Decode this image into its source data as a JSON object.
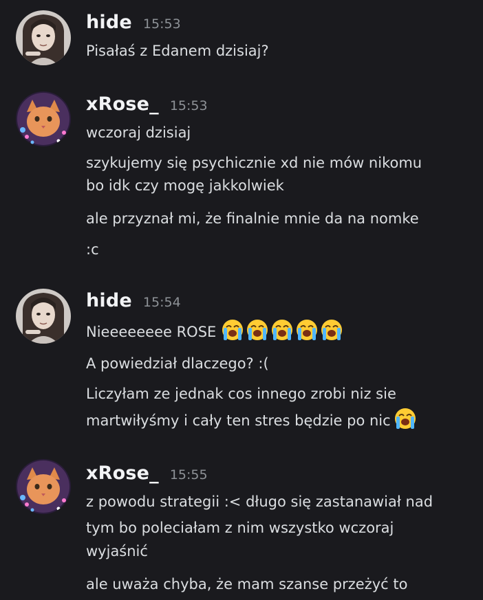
{
  "messages": [
    {
      "username": "hide",
      "timestamp": "15:53",
      "avatar": "hide-avatar",
      "lines": [
        "Pisałaś z Edanem dzisiaj?"
      ]
    },
    {
      "username": "xRose_",
      "timestamp": "15:53",
      "avatar": "xrose-avatar",
      "lines": [
        "wczoraj dzisiaj",
        "szykujemy się psychicznie xd nie mów nikomu",
        "bo idk czy mogę jakkolwiek",
        "ale przyznał mi, że finalnie mnie da na nomke",
        ":c"
      ]
    },
    {
      "username": "hide",
      "timestamp": "15:54",
      "avatar": "hide-avatar",
      "lines": [
        "Nieeeeeeee ROSE",
        "A powiedział dlaczego? :(",
        "Liczyłam ze jednak cos innego zrobi niz sie",
        "martwiłyśmy i cały ten stres będzie po nic"
      ],
      "emojis": {
        "line_1": "loudly-crying-face x5",
        "line_4": "loudly-crying-face x1"
      }
    },
    {
      "username": "xRose_",
      "timestamp": "15:55",
      "avatar": "xrose-avatar",
      "lines": [
        "z powodu strategii :< długo się zastanawiał nad",
        "tym bo poleciałam z nim wszystko wczoraj",
        "wyjaśnić",
        "ale uważa chyba, że mam szanse przeżyć to"
      ]
    }
  ],
  "colors": {
    "background": "#1a1a1e",
    "username": "#f2f3f5",
    "timestamp": "#8e9297",
    "text": "#dbdee1"
  }
}
